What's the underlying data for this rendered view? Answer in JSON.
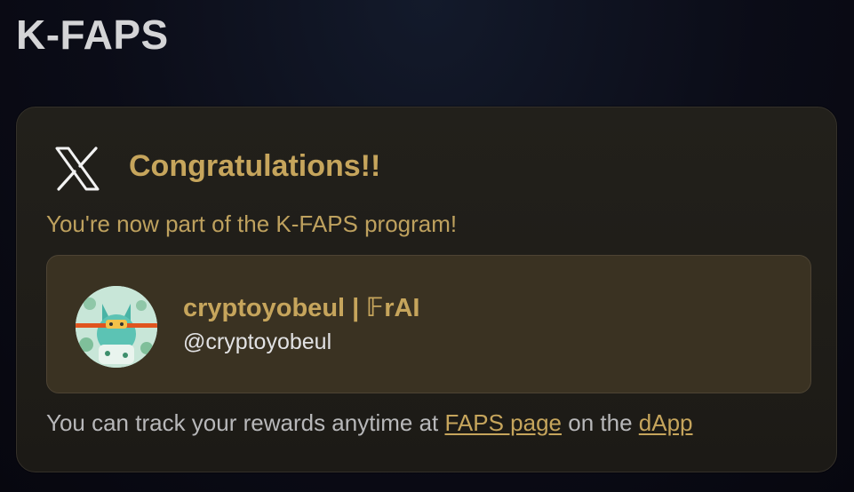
{
  "page": {
    "title": "K-FAPS"
  },
  "card": {
    "logo_icon": "x-logo-icon",
    "heading": "Congratulations!!",
    "subtitle": "You're now part of the K-FAPS program!",
    "profile": {
      "display_name": "cryptoyobeul | 𝔽rAI",
      "handle": "@cryptoyobeul",
      "avatar_icon": "avatar-image"
    },
    "footer": {
      "prefix": "You can track your rewards anytime at ",
      "link1_label": "FAPS page",
      "middle": " on the ",
      "link2_label": "dApp"
    }
  },
  "colors": {
    "accent_gold": "#c6a55c",
    "card_bg": "#22201b",
    "profile_bg": "#3a3222",
    "page_bg": "#0b0c17"
  }
}
